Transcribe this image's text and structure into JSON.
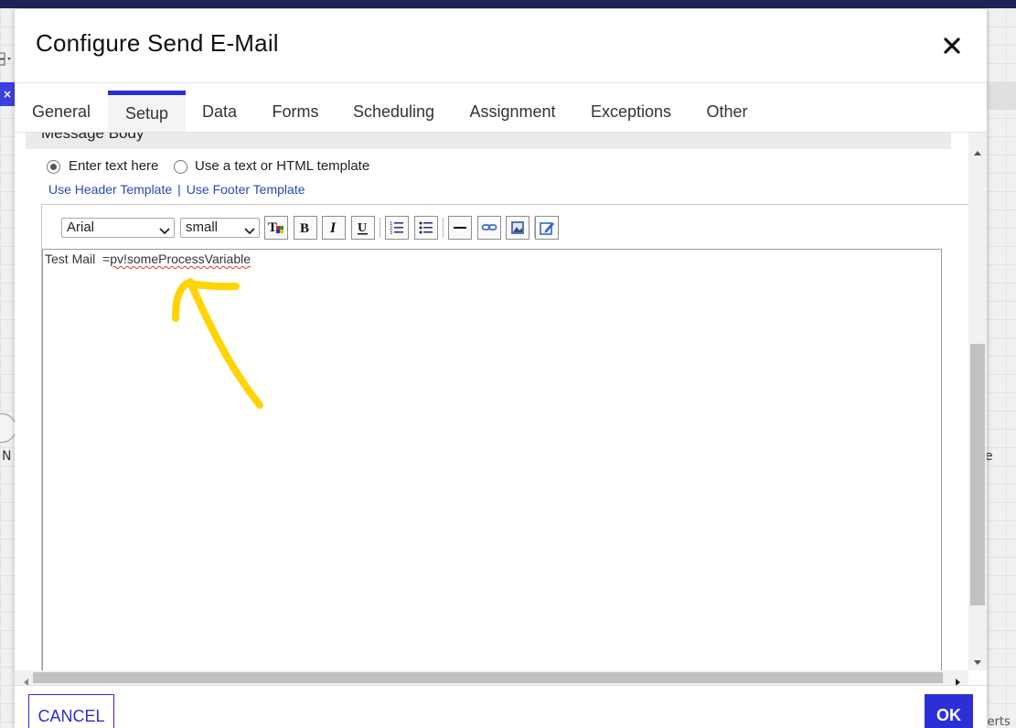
{
  "background": {
    "node_label": "N",
    "right_label": "e",
    "alerts_label": "alerts"
  },
  "dialog": {
    "title": "Configure Send E-Mail",
    "close_icon": "close-icon"
  },
  "tabs": [
    {
      "label": "General",
      "active": false
    },
    {
      "label": "Setup",
      "active": true
    },
    {
      "label": "Data",
      "active": false
    },
    {
      "label": "Forms",
      "active": false
    },
    {
      "label": "Scheduling",
      "active": false
    },
    {
      "label": "Assignment",
      "active": false
    },
    {
      "label": "Exceptions",
      "active": false
    },
    {
      "label": "Other",
      "active": false
    }
  ],
  "message_body": {
    "section_title": "Message Body",
    "radio_options": [
      {
        "label": "Enter text here",
        "checked": true
      },
      {
        "label": "Use a text or HTML template",
        "checked": false
      }
    ],
    "links": {
      "header_template": "Use Header Template",
      "separator": "|",
      "footer_template": "Use Footer Template"
    },
    "toolbar": {
      "font_family": "Arial",
      "font_size": "small",
      "buttons": [
        "text-color-icon",
        "bold-icon",
        "italic-icon",
        "underline-icon",
        "ordered-list-icon",
        "unordered-list-icon",
        "horizontal-rule-icon",
        "link-icon",
        "image-icon",
        "edit-source-icon"
      ]
    },
    "editor": {
      "text_prefix": "Test Mail  =",
      "variable": "pv!someProcessVariable"
    }
  },
  "annotation": {
    "color": "#FFD400"
  },
  "footer": {
    "cancel_label": "CANCEL",
    "ok_label": "OK"
  },
  "colors": {
    "accent": "#2D2FD6",
    "link": "#2A47B8"
  }
}
